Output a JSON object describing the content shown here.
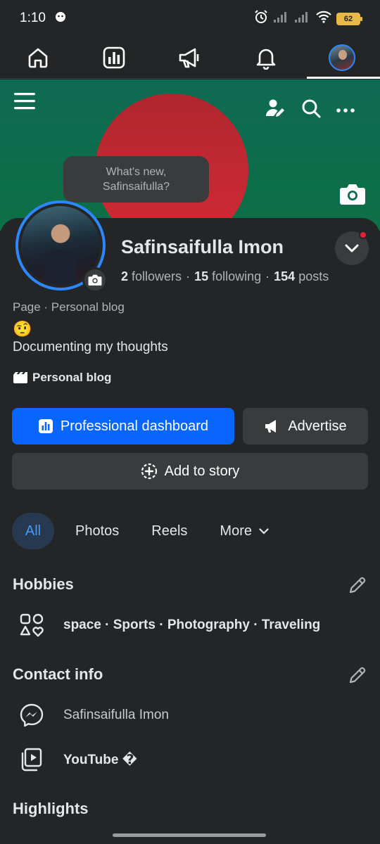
{
  "status": {
    "time": "1:10",
    "battery": "62"
  },
  "nav": {
    "items": [
      {
        "icon": "home-icon"
      },
      {
        "icon": "dashboard-icon"
      },
      {
        "icon": "megaphone-icon"
      },
      {
        "icon": "bell-icon"
      },
      {
        "icon": "profile-avatar-icon"
      }
    ]
  },
  "composer": {
    "line1": "What's new,",
    "line2": "Safinsaifulla?"
  },
  "profile": {
    "name": "Safinsaifulla Imon",
    "followers_count": "2",
    "followers_label": "followers",
    "following_count": "15",
    "following_label": "following",
    "posts_count": "154",
    "posts_label": "posts",
    "subline": "Page · Personal blog",
    "emoji": "🤨",
    "bio": "Documenting my thoughts",
    "category": "Personal blog"
  },
  "actions": {
    "professional_dashboard": "Professional dashboard",
    "advertise": "Advertise",
    "add_to_story": "Add to story"
  },
  "tabs": [
    {
      "label": "All",
      "active": true
    },
    {
      "label": "Photos"
    },
    {
      "label": "Reels"
    },
    {
      "label": "More"
    }
  ],
  "hobbies": {
    "title": "Hobbies",
    "text": "space · Sports · Photography · Traveling"
  },
  "contact": {
    "title": "Contact info",
    "messenger": "Safinsaifulla Imon",
    "youtube": "YouTube �"
  },
  "highlights": {
    "title": "Highlights"
  },
  "colors": {
    "background": "#242526",
    "primary_blue": "#0866ff",
    "button_gray": "#3a3b3c",
    "cover_green": "#0e6a52",
    "cover_red": "#d22a36",
    "notification_red": "#e41e3f"
  }
}
